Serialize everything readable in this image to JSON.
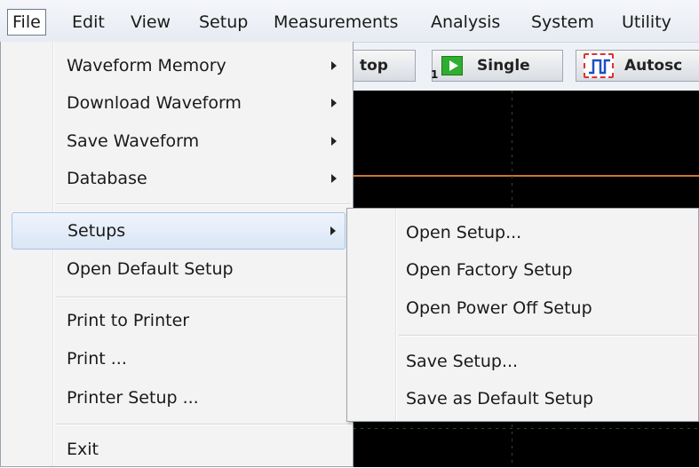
{
  "menubar": {
    "items": [
      "File",
      "Edit",
      "View",
      "Setup",
      "Measurements",
      "Analysis",
      "System",
      "Utility"
    ]
  },
  "toolbar": {
    "stop_label": "top",
    "single_label": "Single",
    "single_icon_text": "1",
    "autoscale_label": "Autosc"
  },
  "file_menu": {
    "items": [
      {
        "label": "Waveform Memory",
        "submenu": true
      },
      {
        "label": "Download Waveform",
        "submenu": true
      },
      {
        "label": "Save Waveform",
        "submenu": true
      },
      {
        "label": "Database",
        "submenu": true
      },
      {
        "label": "Setups",
        "submenu": true,
        "highlighted": true
      },
      {
        "label": "Open Default Setup",
        "submenu": false
      },
      {
        "label": "Print to Printer",
        "submenu": false
      },
      {
        "label": "Print ...",
        "submenu": false
      },
      {
        "label": "Printer Setup ...",
        "submenu": false
      },
      {
        "label": "Exit",
        "submenu": false
      }
    ]
  },
  "setups_submenu": {
    "items": [
      "Open Setup...",
      "Open Factory Setup",
      "Open Power Off Setup",
      "Save Setup...",
      "Save as Default Setup"
    ]
  },
  "colors": {
    "trace": "#c9772d",
    "highlight": "#dae6f5",
    "scope_bg": "#000000"
  }
}
